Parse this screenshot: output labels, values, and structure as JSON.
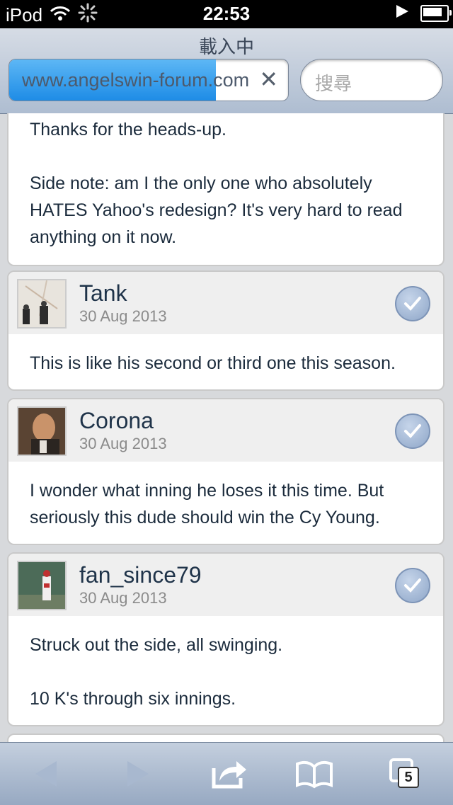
{
  "status": {
    "carrier": "iPod",
    "time": "22:53"
  },
  "browser": {
    "loading_title": "載入中",
    "url": "www.angelswin-forum.com",
    "search_placeholder": "搜尋",
    "load_progress": 0.74
  },
  "posts": [
    {
      "body": [
        "Thanks for the heads-up.",
        "",
        "Side note: am I the only one who absolutely HATES Yahoo's redesign?  It's very hard to read anything on it now."
      ]
    },
    {
      "user": "Tank",
      "date": "30 Aug 2013",
      "body": [
        "This is like his second or third one this season."
      ]
    },
    {
      "user": "Corona",
      "date": "30 Aug 2013",
      "body": [
        "I wonder what inning he loses it this time. But seriously this dude should win the Cy Young."
      ]
    },
    {
      "user": "fan_since79",
      "date": "30 Aug 2013",
      "body": [
        "Struck out the side, all swinging.",
        "",
        "10 K's through six innings."
      ]
    }
  ],
  "toolbar": {
    "tabs_count": "5",
    "icons": [
      "back-arrow-icon",
      "forward-arrow-icon",
      "share-icon",
      "bookmarks-icon",
      "tabs-icon"
    ]
  },
  "colors": {
    "link_text": "#1f3349",
    "progress_blue": "#1e8ce6"
  }
}
